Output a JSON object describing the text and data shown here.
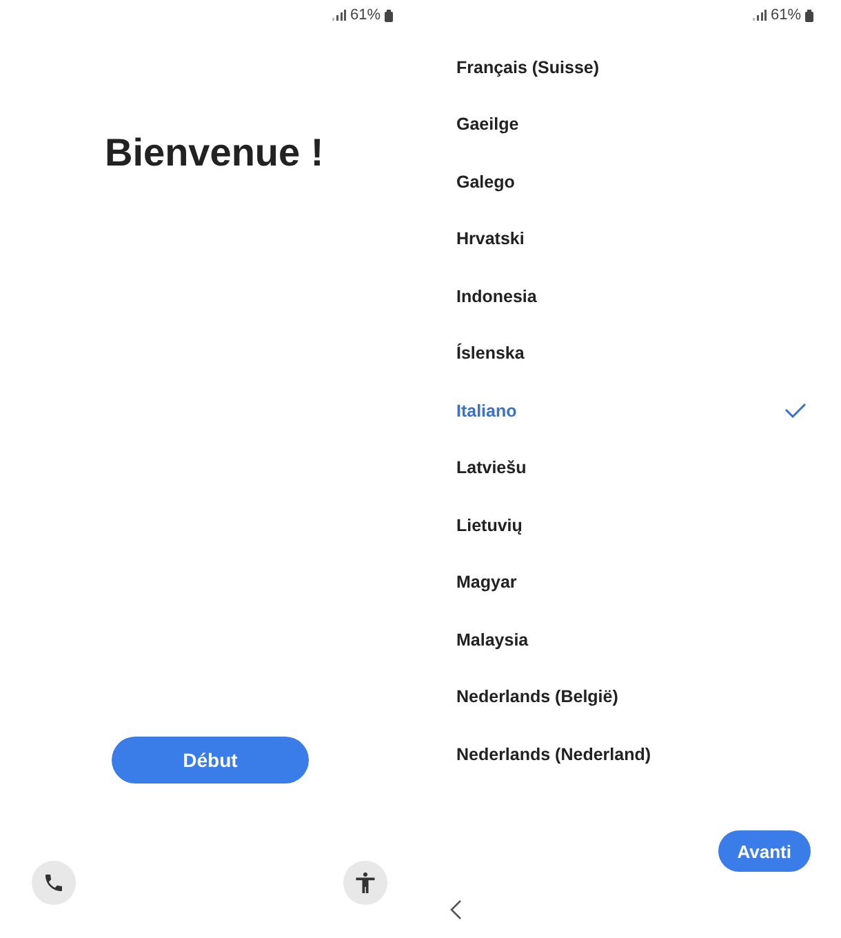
{
  "left": {
    "status_bar": {
      "battery_text": "61%"
    },
    "title": "Bienvenue !",
    "start_button": "Début"
  },
  "right": {
    "status_bar": {
      "battery_text": "61%"
    },
    "languages": [
      {
        "label": "Français (Suisse)",
        "selected": false
      },
      {
        "label": "Gaeilge",
        "selected": false
      },
      {
        "label": "Galego",
        "selected": false
      },
      {
        "label": "Hrvatski",
        "selected": false
      },
      {
        "label": "Indonesia",
        "selected": false
      },
      {
        "label": "Íslenska",
        "selected": false
      },
      {
        "label": "Italiano",
        "selected": true
      },
      {
        "label": "Latviešu",
        "selected": false
      },
      {
        "label": "Lietuvių",
        "selected": false
      },
      {
        "label": "Magyar",
        "selected": false
      },
      {
        "label": "Malaysia",
        "selected": false
      },
      {
        "label": "Nederlands (België)",
        "selected": false
      },
      {
        "label": "Nederlands (Nederland)",
        "selected": false
      }
    ],
    "next_button": "Avanti"
  }
}
